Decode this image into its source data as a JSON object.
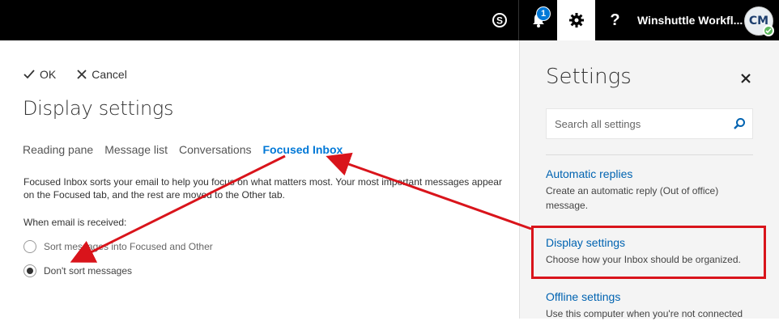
{
  "topbar": {
    "user_name": "Winshuttle Workfl...",
    "notification_count": "1",
    "avatar_initials": "CM",
    "icons": [
      "skype-icon",
      "bell-icon",
      "gear-icon",
      "help-icon"
    ],
    "help_glyph": "?"
  },
  "actions": {
    "ok_label": "OK",
    "cancel_label": "Cancel"
  },
  "page": {
    "title": "Display settings",
    "tabs": [
      {
        "label": "Reading pane",
        "active": false
      },
      {
        "label": "Message list",
        "active": false
      },
      {
        "label": "Conversations",
        "active": false
      },
      {
        "label": "Focused Inbox",
        "active": true
      }
    ],
    "description": "Focused Inbox sorts your email to help you focus on what matters most. Your most important messages appear on the Focused tab, and the rest are moved to the Other tab.",
    "when_label": "When email is received:",
    "options": [
      {
        "label": "Sort messages into Focused and Other",
        "selected": false
      },
      {
        "label": "Don't sort messages",
        "selected": true
      }
    ]
  },
  "settings_panel": {
    "title": "Settings",
    "search_placeholder": "Search all settings",
    "items": [
      {
        "link": "Automatic replies",
        "description": "Create an automatic reply (Out of office) message."
      },
      {
        "link": "Display settings",
        "description": "Choose how your Inbox should be organized."
      },
      {
        "link": "Offline settings",
        "description": "Use this computer when you're not connected"
      }
    ]
  },
  "colors": {
    "topbar_bg": "#000000",
    "accent": "#0078d7",
    "annotation_red": "#d9141b",
    "panel_bg": "#f4f4f4"
  }
}
